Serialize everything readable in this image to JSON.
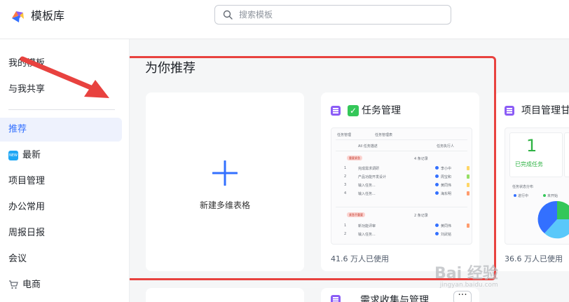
{
  "app": {
    "title": "模板库"
  },
  "search": {
    "placeholder": "搜索模板"
  },
  "sidebar": {
    "items": [
      {
        "label": "我的模板"
      },
      {
        "label": "与我共享"
      },
      {
        "label": "推荐"
      },
      {
        "label": "最新",
        "badge": "NEW"
      },
      {
        "label": "项目管理"
      },
      {
        "label": "办公常用"
      },
      {
        "label": "周报日报"
      },
      {
        "label": "会议"
      },
      {
        "label": "电商"
      }
    ]
  },
  "main": {
    "section_title": "为你推荐",
    "new_card": {
      "label": "新建多维表格"
    },
    "templates": [
      {
        "title": "任务管理",
        "usage": "41.6 万人已使用",
        "preview": {
          "tab1": "任务管理",
          "tab2": "任务管理表",
          "col1": "All 任务描述",
          "col2": "任务执行人",
          "group1": "重要紧急",
          "group1_count": "4 条记录",
          "group2": "紧急不重要",
          "group2_count": "2 条记录",
          "rows1": [
            {
              "task": "完成需求调研",
              "owner": "李小中"
            },
            {
              "task": "产品功能开发设计",
              "owner": "周宝和"
            },
            {
              "task": "输入任务...",
              "owner": "黄同伟"
            },
            {
              "task": "输入任务...",
              "owner": "海东明"
            }
          ],
          "rows2": [
            {
              "task": "新功能评审",
              "owner": "黄同伟"
            },
            {
              "task": "输入任务...",
              "owner": "刘武铭"
            }
          ]
        }
      },
      {
        "title": "项目管理甘",
        "usage": "36.6 万人已使用",
        "preview": {
          "big_number": "1",
          "metric_label": "已完成任务",
          "chart_title": "任务状态分布",
          "legend": [
            "进行中",
            "未开始"
          ]
        }
      }
    ],
    "bottom_templates": [
      {
        "title": "需求收集与管理"
      }
    ]
  },
  "colors": {
    "accent": "#3370ff",
    "highlight_border": "#e8423f",
    "arrow": "#e8423f",
    "template_icon": "#8b5cf6",
    "check": "#34c759",
    "metric_green": "#2fb344"
  },
  "watermark": {
    "brand": "Bai 经验",
    "url": "jingyan.baidu.com"
  }
}
